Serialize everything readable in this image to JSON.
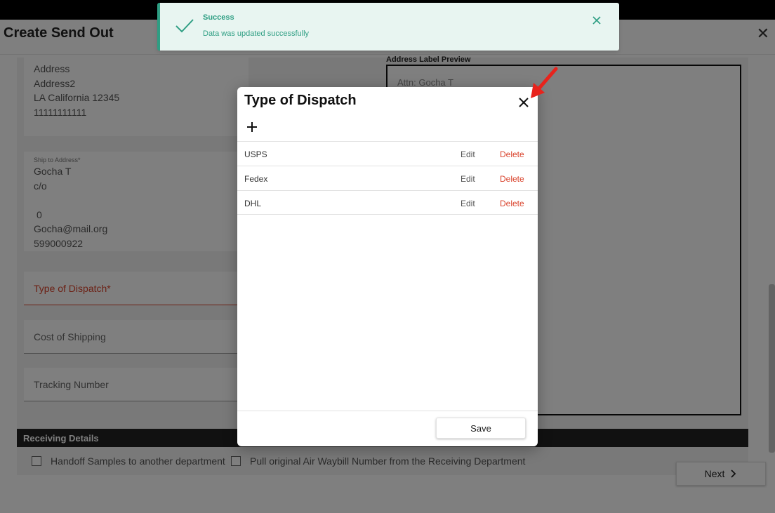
{
  "page": {
    "title": "Create Send Out"
  },
  "bill_address": {
    "lines": [
      "Address",
      "Address2",
      "LA California 12345",
      "11111111111"
    ]
  },
  "ship_address": {
    "label": "Ship to Address*",
    "lines": [
      "Gocha T",
      "c/o",
      "",
      "0",
      "Gocha@mail.org",
      "599000922"
    ]
  },
  "fields": {
    "type_of_dispatch": "Type of Dispatch*",
    "cost_of_shipping": "Cost of Shipping",
    "tracking_number": "Tracking Number"
  },
  "preview": {
    "title": "Address Label Preview",
    "attn": "Attn: Gocha T"
  },
  "receiving": {
    "title": "Receiving Details",
    "handoff_label": "Handoff Samples to another department",
    "pull_label": "Pull original Air Waybill Number from the Receiving Department"
  },
  "footer": {
    "next_label": "Next"
  },
  "modal": {
    "title": "Type of Dispatch",
    "items": [
      {
        "name": "USPS",
        "edit": "Edit",
        "delete": "Delete"
      },
      {
        "name": "Fedex",
        "edit": "Edit",
        "delete": "Delete"
      },
      {
        "name": "DHL",
        "edit": "Edit",
        "delete": "Delete"
      }
    ],
    "save_label": "Save"
  },
  "toast": {
    "title": "Success",
    "message": "Data was updated successfully"
  },
  "colors": {
    "accent_success": "#2e9e83",
    "danger": "#d9422b",
    "arrow": "#e8231c"
  },
  "icons": [
    "close-icon",
    "plus-icon",
    "check-icon",
    "chevron-right-icon",
    "arrow-annotation-icon"
  ]
}
